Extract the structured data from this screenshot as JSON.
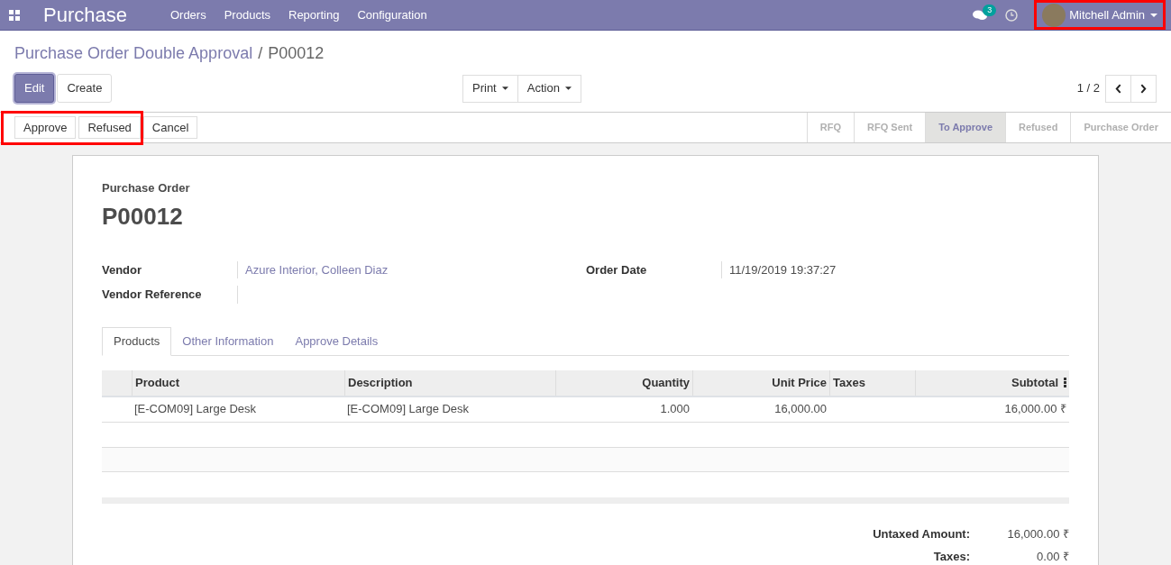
{
  "navbar": {
    "app_name": "Purchase",
    "menu": [
      "Orders",
      "Products",
      "Reporting",
      "Configuration"
    ],
    "messages_count": "3",
    "user": "Mitchell Admin",
    "user_highlighted": true
  },
  "breadcrumb": {
    "parent": "Purchase Order Double Approval",
    "separator": "/",
    "current": "P00012"
  },
  "buttons": [
    {
      "label": "Edit",
      "primary": true
    },
    {
      "label": "Create",
      "primary": false
    }
  ],
  "dropdowns": [
    "Print",
    "Action"
  ],
  "pager": "1 / 2",
  "header_buttons": [
    {
      "label": "Approve",
      "highlighted": true
    },
    {
      "label": "Refused",
      "highlighted": true
    },
    {
      "label": "Cancel",
      "highlighted": false
    }
  ],
  "statusbar": [
    {
      "label": "RFQ",
      "selected": false
    },
    {
      "label": "RFQ Sent",
      "selected": false
    },
    {
      "label": "To Approve",
      "selected": true
    },
    {
      "label": "Refused",
      "selected": false
    },
    {
      "label": "Purchase Order",
      "selected": false
    }
  ],
  "sheet": {
    "subtitle": "Purchase Order",
    "title": "P00012",
    "left_fields": [
      {
        "label": "Vendor",
        "value": "Azure Interior, Colleen Diaz"
      },
      {
        "label": "Vendor Reference"
      }
    ],
    "right_fields": [
      {
        "label": "Order Date",
        "value": "11/19/2019 19:37:27"
      }
    ],
    "tabs": [
      {
        "label": "Products",
        "selected": true
      },
      {
        "label": "Other Information",
        "selected": false
      },
      {
        "label": "Approve Details",
        "selected": false
      }
    ],
    "table": {
      "columns": [
        "Product",
        "Description",
        "Quantity",
        "Unit Price",
        "Taxes",
        "Subtotal"
      ],
      "rows": [
        [
          "[E-COM09] Large Desk",
          "[E-COM09] Large Desk",
          "1.000",
          "16,000.00",
          "",
          "16,000.00 ₹"
        ]
      ]
    },
    "totals": [
      {
        "label": "Untaxed Amount:",
        "value": "16,000.00 ₹"
      },
      {
        "label": "Taxes:",
        "value": "0.00 ₹"
      }
    ]
  }
}
